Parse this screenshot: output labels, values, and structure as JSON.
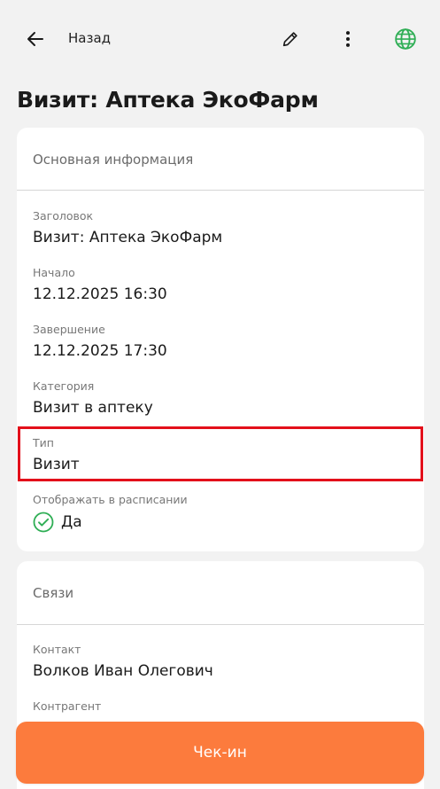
{
  "header": {
    "back_label": "Назад"
  },
  "page": {
    "title": "Визит: Аптека ЭкоФарм"
  },
  "main_section": {
    "header": "Основная информация",
    "fields": [
      {
        "label": "Заголовок",
        "value": "Визит: Аптека ЭкоФарм"
      },
      {
        "label": "Начало",
        "value": "12.12.2025 16:30"
      },
      {
        "label": "Завершение",
        "value": "12.12.2025 17:30"
      },
      {
        "label": "Категория",
        "value": "Визит в аптеку"
      },
      {
        "label": "Тип",
        "value": "Визит"
      }
    ],
    "schedule": {
      "label": "Отображать в расписании",
      "value": "Да"
    }
  },
  "links_section": {
    "header": "Связи",
    "fields": [
      {
        "label": "Контакт",
        "value": "Волков Иван Олегович"
      },
      {
        "label": "Контрагент",
        "value": ""
      }
    ]
  },
  "actions": {
    "checkin_label": "Чек-ин"
  },
  "colors": {
    "accent": "#fc7b3d",
    "highlight": "#e3101b",
    "success": "#2fae55"
  },
  "icons": {
    "back": "arrow-left-icon",
    "edit": "pencil-icon",
    "more": "more-vertical-icon",
    "globe": "globe-icon",
    "check": "check-circle-icon"
  }
}
